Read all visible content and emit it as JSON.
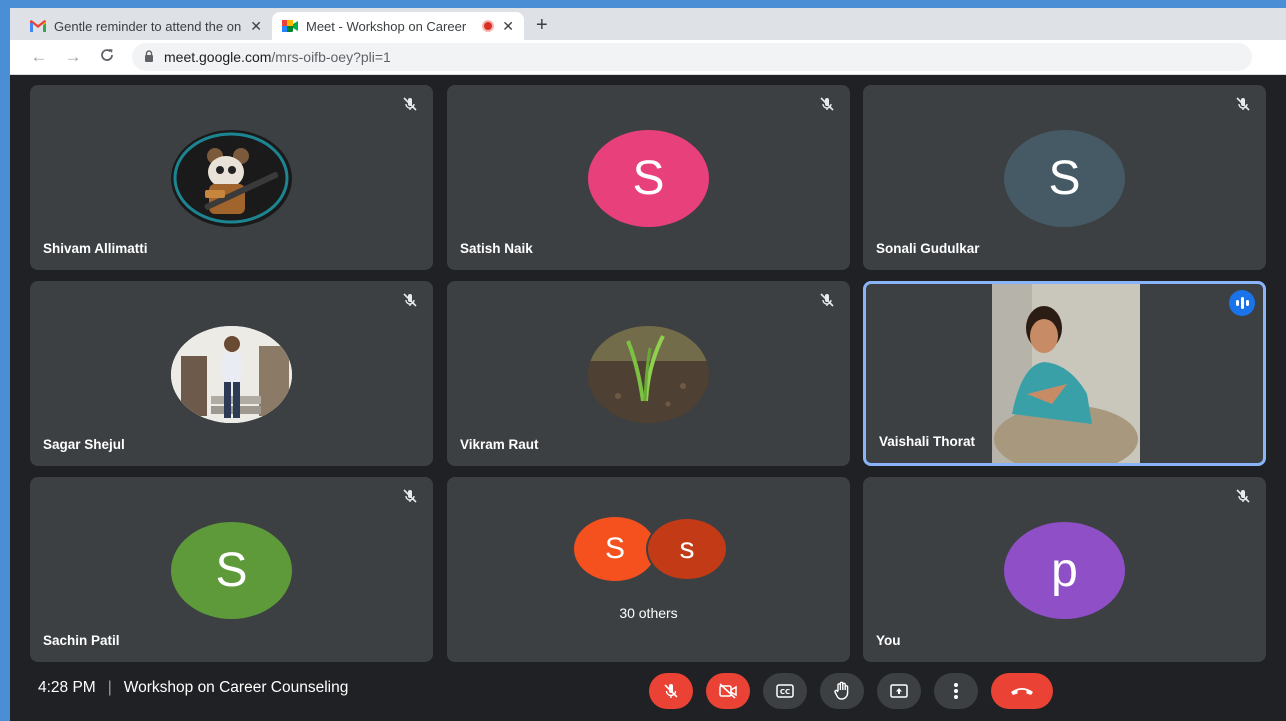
{
  "browser": {
    "tabs": [
      {
        "title": "Gentle reminder to attend the on",
        "close": "✕",
        "active": false
      },
      {
        "title": "Meet - Workshop on Career",
        "close": "✕",
        "active": true
      }
    ],
    "new_tab": "+",
    "nav": {
      "back": "←",
      "forward": "→",
      "reload": "C"
    },
    "url_host": "meet.google.com",
    "url_path": "/mrs-oifb-oey?pli=1"
  },
  "participants": [
    {
      "name": "Shivam Allimatti",
      "avatar_type": "image",
      "muted": true
    },
    {
      "name": "Satish Naik",
      "avatar_type": "letter",
      "letter": "S",
      "color": "#e8407a",
      "muted": true
    },
    {
      "name": "Sonali Gudulkar",
      "avatar_type": "letter",
      "letter": "S",
      "color": "#455a64",
      "muted": true
    },
    {
      "name": "Sagar Shejul",
      "avatar_type": "image",
      "muted": true
    },
    {
      "name": "Vikram Raut",
      "avatar_type": "image",
      "muted": true
    },
    {
      "name": "Vaishali Thorat",
      "avatar_type": "video",
      "speaking": true
    },
    {
      "name": "Sachin Patil",
      "avatar_type": "letter",
      "letter": "S",
      "color": "#5e9a3a",
      "muted": true
    },
    {
      "name": "You",
      "avatar_type": "letter",
      "letter": "p",
      "color": "#8e4fc7",
      "muted": true
    }
  ],
  "others": {
    "label": "30 others",
    "avatars": [
      {
        "letter": "S",
        "color": "#f4511e"
      },
      {
        "letter": "s",
        "color": "#c23b16"
      }
    ]
  },
  "footer": {
    "time": "4:28 PM",
    "separator": "|",
    "meeting_title": "Workshop on Career Counseling"
  },
  "controls": [
    {
      "name": "mic-off-button",
      "icon": "mic-off-icon",
      "color": "#ea4335"
    },
    {
      "name": "camera-off-button",
      "icon": "camera-off-icon",
      "color": "#ea4335"
    },
    {
      "name": "captions-button",
      "icon": "captions-icon",
      "color": "#3c4043"
    },
    {
      "name": "raise-hand-button",
      "icon": "hand-icon",
      "color": "#3c4043"
    },
    {
      "name": "present-button",
      "icon": "present-icon",
      "color": "#3c4043"
    },
    {
      "name": "more-options-button",
      "icon": "more-vert-icon",
      "color": "#3c4043"
    },
    {
      "name": "leave-call-button",
      "icon": "end-call-icon",
      "color": "#ea4335"
    }
  ]
}
